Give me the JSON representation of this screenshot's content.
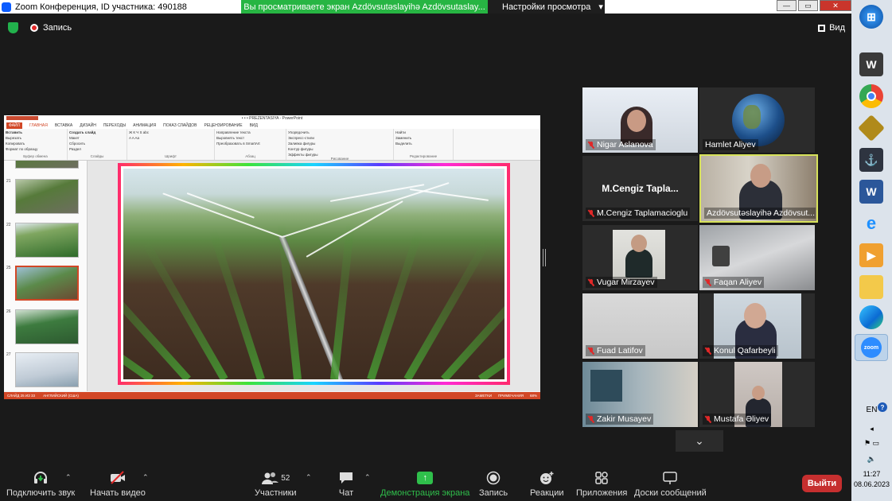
{
  "window": {
    "title": "Zoom Конференция, ID участника: 490188",
    "share_banner": "Вы просматриваете экран Azdövsutəslayihə Azdövsutaslay...",
    "view_options": "Настройки просмотра",
    "view_options_caret": "▾"
  },
  "zoom_top": {
    "recording_label": "Запись",
    "view_label": "Вид"
  },
  "ppt": {
    "title": "• • • PREZENTASIYA  -  PowerPoint",
    "tabs": [
      "ФАЙЛ",
      "ГЛАВНАЯ",
      "ВСТАВКА",
      "ДИЗАЙН",
      "ПЕРЕХОДЫ",
      "АНИМАЦИЯ",
      "ПОКАЗ СЛАЙДОВ",
      "РЕЦЕНЗИРОВАНИЕ",
      "ВИД"
    ],
    "ribbon_groups": [
      {
        "name": "Буфер обмена",
        "items": [
          "Вырезать",
          "Копировать",
          "Формат по образцу"
        ],
        "main": "Вставить"
      },
      {
        "name": "Слайды",
        "items": [
          "Макет",
          "Сбросить",
          "Раздел"
        ],
        "main": "Создать слайд"
      },
      {
        "name": "Шрифт",
        "items": [
          "Ж К Ч S abc",
          "A A Aa"
        ]
      },
      {
        "name": "Абзац",
        "items": [
          "Направление текста",
          "Выровнять текст",
          "Преобразовать в SmartArt"
        ]
      },
      {
        "name": "Рисование",
        "items": [
          "Упорядочить",
          "Экспресс-стили",
          "Заливка фигуры",
          "Контур фигуры",
          "Эффекты фигуры"
        ]
      },
      {
        "name": "Редактирование",
        "items": [
          "Найти",
          "Заменить",
          "Выделить"
        ]
      }
    ],
    "thumb_numbers": [
      "21",
      "22",
      "25",
      "26",
      "27"
    ],
    "status_left": [
      "СЛАЙД 25 ИЗ 33",
      "АНГЛИЙСКИЙ (США)"
    ],
    "status_right": [
      "ЗАМЕТКИ",
      "ПРИМЕЧАНИЯ",
      "68%"
    ]
  },
  "participants": [
    {
      "name": "Nigar Aslanova",
      "muted": true
    },
    {
      "name": "Hamlet Aliyev",
      "muted": false
    },
    {
      "name": "M.Cengiz Taplamacioglu",
      "muted": true,
      "avatar_text": "M.Cengiz  Tapla..."
    },
    {
      "name": "Azdövsutəslayihə Azdövsut...",
      "muted": false,
      "active_speaker": true
    },
    {
      "name": "Vugar Mirzayev",
      "muted": true
    },
    {
      "name": "Faqan Aliyev",
      "muted": true
    },
    {
      "name": "Fuad Latifov",
      "muted": true
    },
    {
      "name": "Konul Qafarbeyli",
      "muted": true
    },
    {
      "name": "Zakir Musayev",
      "muted": true
    },
    {
      "name": "Mustafa Əliyev",
      "muted": true
    }
  ],
  "toolbar": {
    "audio": "Подключить звук",
    "video": "Начать видео",
    "participants": "Участники",
    "participants_count": "52",
    "chat": "Чат",
    "share": "Демонстрация экрана",
    "record": "Запись",
    "reactions": "Реакции",
    "apps": "Приложения",
    "whiteboards": "Доски сообщений",
    "leave": "Выйти"
  },
  "taskbar": {
    "icons": [
      "windows-start-icon",
      "world-of-tanks-icon",
      "chrome-icon",
      "game-icon",
      "world-of-warships-icon",
      "word-icon",
      "internet-explorer-icon",
      "media-player-icon",
      "file-explorer-icon",
      "edge-icon",
      "zoom-icon"
    ],
    "zoom_label": "zoom",
    "lang": "EN",
    "time": "11:27",
    "date": "08.06.2023"
  },
  "colors": {
    "share_green": "#27b543",
    "leave_red": "#c62f2f",
    "ppt_accent": "#d24726",
    "active_border": "#d7e25a"
  }
}
